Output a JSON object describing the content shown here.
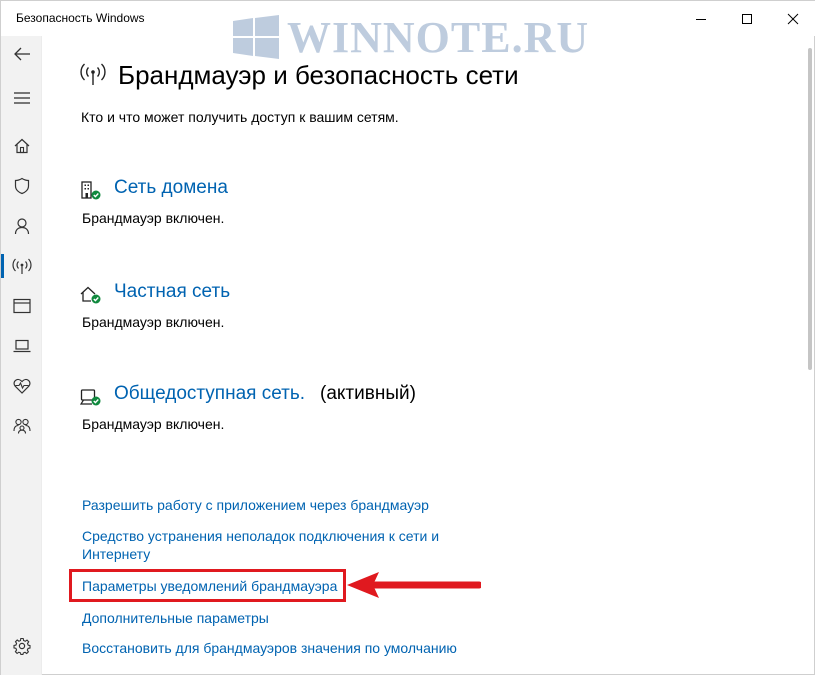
{
  "window": {
    "title": "Безопасность Windows"
  },
  "watermark": {
    "text": "WINNOTE.RU"
  },
  "rail": {
    "items": [
      {
        "icon": "back-arrow-icon"
      },
      {
        "icon": "hamburger-menu-icon"
      },
      {
        "icon": "home-icon"
      },
      {
        "icon": "shield-icon"
      },
      {
        "icon": "person-icon"
      },
      {
        "icon": "wireless-signal-icon",
        "active": true
      },
      {
        "icon": "app-browser-icon"
      },
      {
        "icon": "laptop-icon"
      },
      {
        "icon": "heart-pulse-icon"
      },
      {
        "icon": "family-icon"
      },
      {
        "icon": "gear-icon"
      }
    ]
  },
  "page": {
    "title": "Брандмауэр и безопасность сети",
    "description": "Кто и что может получить доступ к вашим сетям."
  },
  "networks": [
    {
      "name": "Сеть домена",
      "status": "Брандмауэр включен.",
      "icon": "domain-network-icon"
    },
    {
      "name": "Частная сеть",
      "status": "Брандмауэр включен.",
      "icon": "private-network-icon"
    },
    {
      "name": "Общедоступная сеть.",
      "active_label": "(активный)",
      "status": "Брандмауэр включен.",
      "icon": "public-network-icon"
    }
  ],
  "links": {
    "allow_app": "Разрешить работу с приложением через брандмауэр",
    "troubleshooter_line1": "Средство устранения неполадок подключения к сети и",
    "troubleshooter_line2": "Интернету",
    "notifications": "Параметры уведомлений брандмауэра",
    "advanced": "Дополнительные параметры",
    "restore_defaults": "Восстановить для брандмауэров значения по умолчанию"
  },
  "colors": {
    "accent": "#0063b1",
    "annotation": "#e0191f",
    "status_ok": "#10893e"
  }
}
